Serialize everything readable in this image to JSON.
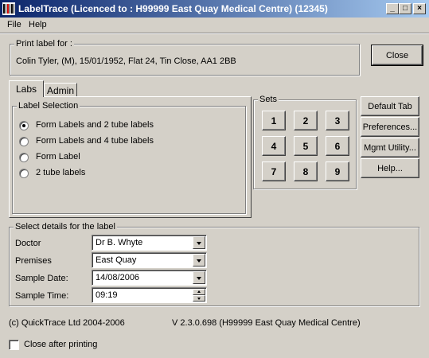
{
  "window": {
    "title": "LabelTrace (Licenced to : H99999  East Quay Medical Centre) (12345)",
    "controls": {
      "minimize": "_",
      "maximize": "□",
      "close": "×"
    }
  },
  "menu": {
    "file": "File",
    "help": "Help"
  },
  "print_label": {
    "legend": "Print label for :",
    "patient": "Colin Tyler, (M), 15/01/1952, Flat 24, Tin Close, AA1  2BB"
  },
  "close_button": "Close",
  "tabs": {
    "labs": "Labs",
    "admin": "Admin"
  },
  "label_selection": {
    "legend": "Label Selection",
    "options": [
      {
        "label": "Form Labels and 2 tube labels",
        "selected": true
      },
      {
        "label": "Form Labels and 4 tube labels",
        "selected": false
      },
      {
        "label": "Form Label",
        "selected": false
      },
      {
        "label": "2 tube labels",
        "selected": false
      }
    ]
  },
  "sets": {
    "legend": "Sets",
    "buttons": [
      "1",
      "2",
      "3",
      "4",
      "5",
      "6",
      "7",
      "8",
      "9"
    ]
  },
  "side_buttons": {
    "default_tab": "Default Tab",
    "preferences": "Preferences...",
    "mgmt_utility": "Mgmt Utility...",
    "help": "Help..."
  },
  "details": {
    "legend": "Select details for the label",
    "doctor_label": "Doctor",
    "doctor_value": "Dr B. Whyte",
    "premises_label": "Premises",
    "premises_value": "East Quay",
    "sample_date_label": "Sample Date:",
    "sample_date_value": "14/08/2006",
    "sample_time_label": "Sample Time:",
    "sample_time_value": "09:19"
  },
  "footer": {
    "copyright": "(c) QuickTrace Ltd 2004-2006",
    "version": "V 2.3.0.698  (H99999  East Quay Medical Centre)",
    "close_after_printing": "Close after printing",
    "close_after_printing_checked": false
  },
  "colors": {
    "titlebar_start": "#0a246a",
    "titlebar_end": "#a6caf0",
    "face": "#d4d0c8"
  }
}
